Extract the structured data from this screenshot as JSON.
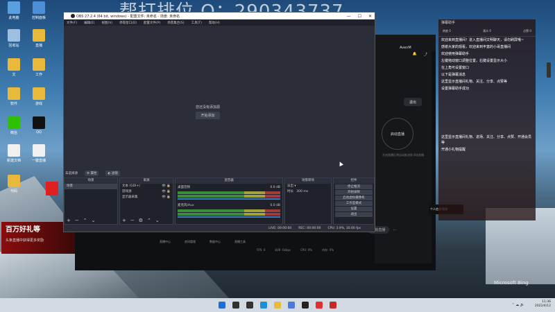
{
  "watermark": "帮打排位 Q：290343737",
  "desktop_icons": [
    {
      "label": "此电脑",
      "icon": "computer-icon",
      "color": "#5aa0e0"
    },
    {
      "label": "控制面板",
      "icon": "control-panel-icon",
      "color": "#4c8fd8"
    },
    {
      "label": "回收站",
      "icon": "recycle-bin-icon",
      "color": "#9fbfe0"
    },
    {
      "label": "直播",
      "icon": "folder-icon",
      "color": "#e8b93a"
    },
    {
      "label": "文",
      "icon": "folder-icon",
      "color": "#e8b93a"
    },
    {
      "label": "工作",
      "icon": "folder-icon",
      "color": "#e8b93a"
    },
    {
      "label": "软件",
      "icon": "folder-icon",
      "color": "#e8b93a"
    },
    {
      "label": "游戏",
      "icon": "folder-icon",
      "color": "#e8b93a"
    },
    {
      "label": "微信",
      "icon": "wechat-icon",
      "color": "#2dc100"
    },
    {
      "label": "QQ",
      "icon": "qq-icon",
      "color": "#111111"
    },
    {
      "label": "新建文档",
      "icon": "document-icon",
      "color": "#f0f0f0"
    },
    {
      "label": "一键直播",
      "icon": "document-icon",
      "color": "#f0f0f0"
    },
    {
      "label": "代码",
      "icon": "folder-icon",
      "color": "#e8b93a"
    }
  ],
  "obs": {
    "title": "OBS 27.2.4 (64 bit, windows) - 配置文件: 未命名 - 场景: 未命名",
    "menu": [
      "文件(F)",
      "编辑(E)",
      "视图(V)",
      "停靠窗口(D)",
      "配置文件(P)",
      "场景集合(S)",
      "工具(T)",
      "帮助(H)"
    ],
    "no_source_text": "您还没有添加源",
    "add_source_btn": "开始添加",
    "no_source_selected": "未选择源",
    "props_btn": "属性",
    "filters_btn": "滤镜",
    "docks": {
      "scenes": {
        "title": "场景",
        "items": [
          "场景"
        ]
      },
      "sources": {
        "title": "来源",
        "items": [
          "文本 (GDI+)",
          "游戏源",
          "显示器采集"
        ]
      },
      "mixer": {
        "title": "混音器",
        "channels": [
          {
            "name": "桌面音频",
            "level": "0.0 dB"
          },
          {
            "name": "麦克风/Aux",
            "level": "0.0 dB"
          }
        ]
      },
      "transitions": {
        "title": "场景转场",
        "type": "淡出",
        "duration_label": "时长",
        "duration": "300 ms"
      },
      "controls": {
        "title": "控件",
        "buttons": [
          "停止推流",
          "开始录制",
          "启动虚拟摄像机",
          "工作室模式",
          "设置",
          "退出"
        ]
      }
    },
    "status": {
      "live": "LIVE: 00:00:00",
      "rec": "REC: 00:00:00",
      "cpu": "CPU: 3.9%, 30.00 fps"
    }
  },
  "helper": {
    "user": "AvenM",
    "exit": "退出",
    "start": "启动直播",
    "hint": "开启直播后将自动推流到 B站直播",
    "bottom_btn": "开始直播",
    "gift": "个人信息/帮助"
  },
  "promo": {
    "title": "百万好礼等",
    "sub": "头条直播中获得更多奖励"
  },
  "browser": {
    "list": [
      "直播中心",
      "房间管理",
      "数据中心",
      "直播工具"
    ],
    "footer": [
      "FPS: 0",
      "码率: 0kbps",
      "CPU: 0%",
      "内存: 0%"
    ]
  },
  "chat": {
    "title": "弹幕助手",
    "stats": [
      "热度 0",
      "观众 0",
      "点赞 0"
    ],
    "lines": [
      "欢迎来到直播间！进入直播间文明聊天，请勿刷屏哦~",
      "感谢大家的观看，欢迎来到丰富的小哥直播间",
      "欢迎使用弹幕助手",
      "左键拖动窗口调整位置，右键设置显示大小",
      "在上角可设置窗口",
      "以下是弹幕消息",
      "这里显示直播间礼物、关注、分享、点赞等",
      "设置弹幕助手成功"
    ],
    "mid_lines": [
      "这里显示直播间礼物、进场、关注、分享、点赞、开通会员等",
      "开通小礼物提醒"
    ]
  },
  "bing": "Microsoft Bing",
  "clock": {
    "time": "11:36",
    "date": "2022/4/12"
  },
  "taskbar_icons": [
    {
      "icon": "start-icon",
      "color": "#1e6fd9"
    },
    {
      "icon": "search-icon",
      "color": "#333333"
    },
    {
      "icon": "taskview-icon",
      "color": "#333333"
    },
    {
      "icon": "edge-icon",
      "color": "#1f8ed8"
    },
    {
      "icon": "explorer-icon",
      "color": "#e8b93a"
    },
    {
      "icon": "store-icon",
      "color": "#4c7ad8"
    },
    {
      "icon": "obs-taskbar-icon",
      "color": "#222222"
    },
    {
      "icon": "helper-taskbar-icon",
      "color": "#e03030"
    },
    {
      "icon": "app-taskbar-icon",
      "color": "#c22a2a"
    }
  ]
}
